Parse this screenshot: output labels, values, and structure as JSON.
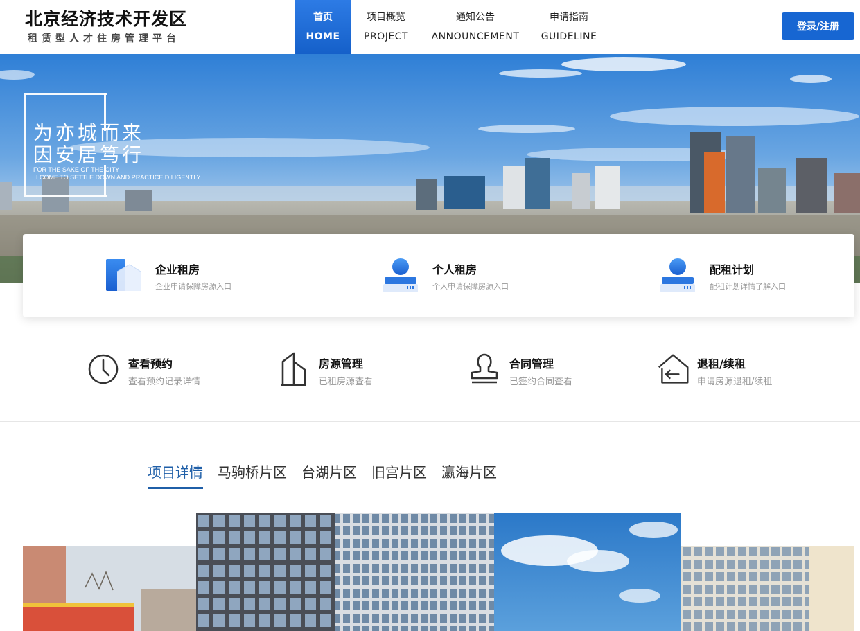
{
  "header": {
    "logo_title": "北京经济技术开发区",
    "logo_subtitle": "租赁型人才住房管理平台",
    "nav": [
      {
        "zh": "首页",
        "en": "HOME",
        "active": true
      },
      {
        "zh": "项目概览",
        "en": "PROJECT",
        "active": false
      },
      {
        "zh": "通知公告",
        "en": "ANNOUNCEMENT",
        "active": false
      },
      {
        "zh": "申请指南",
        "en": "GUIDELINE",
        "active": false
      }
    ],
    "login_label": "登录/注册"
  },
  "banner": {
    "slogan_line1": "为亦城而来",
    "slogan_line2": "因安居笃行",
    "slogan_en_line1": "FOR THE SAKE OF THE CITY",
    "slogan_en_line2": "I COME TO SETTLE DOWN AND PRACTICE DILIGENTLY"
  },
  "quick_entries": [
    {
      "title": "企业租房",
      "desc": "企业申请保障房源入口",
      "icon": "enterprise-building-icon"
    },
    {
      "title": "个人租房",
      "desc": "个人申请保障房源入口",
      "icon": "person-icon"
    },
    {
      "title": "配租计划",
      "desc": "配租计划详情了解入口",
      "icon": "plan-person-icon"
    }
  ],
  "services": [
    {
      "title": "查看预约",
      "desc": "查看预约记录详情",
      "icon": "clock-icon"
    },
    {
      "title": "房源管理",
      "desc": "已租房源查看",
      "icon": "building-icon"
    },
    {
      "title": "合同管理",
      "desc": "已签约合同查看",
      "icon": "stamp-icon"
    },
    {
      "title": "退租/续租",
      "desc": "申请房源退租/续租",
      "icon": "house-return-icon"
    }
  ],
  "tabs": [
    {
      "label": "项目详情",
      "active": true
    },
    {
      "label": "马驹桥片区",
      "active": false
    },
    {
      "label": "台湖片区",
      "active": false
    },
    {
      "label": "旧宫片区",
      "active": false
    },
    {
      "label": "瀛海片区",
      "active": false
    }
  ],
  "colors": {
    "primary": "#1766d2",
    "tab_active": "#1f5fa8",
    "muted_text": "#999999"
  }
}
